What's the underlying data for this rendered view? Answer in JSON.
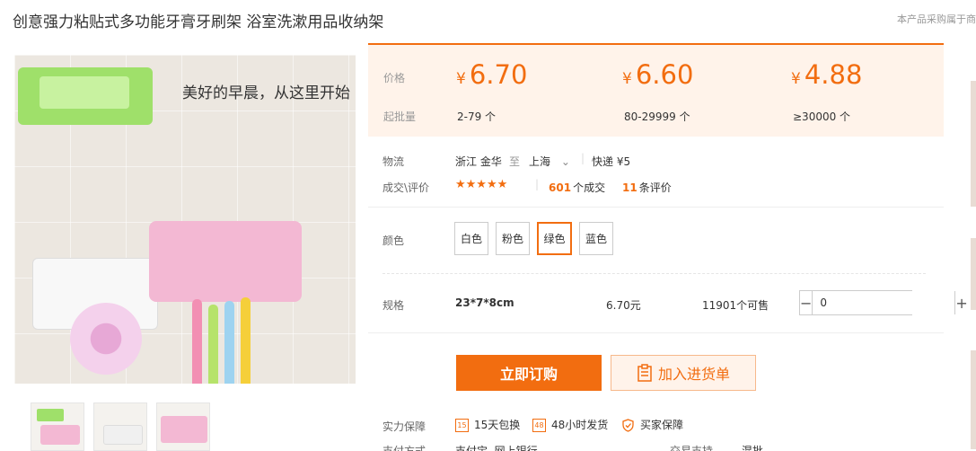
{
  "product": {
    "title": "创意强力粘贴式多功能牙膏牙刷架 浴室洗漱用品收纳架",
    "top_right_note": "本产品采购属于商",
    "image_slogan": "美好的早晨，从这里开始"
  },
  "price_panel": {
    "price_label": "价格",
    "moq_label": "起批量",
    "currency_symbol": "¥",
    "tiers": [
      {
        "price": "6.70",
        "qty": "2-79 个"
      },
      {
        "price": "6.60",
        "qty": "80-29999 个"
      },
      {
        "price": "4.88",
        "qty": "≥30000 个"
      }
    ]
  },
  "logistics": {
    "label": "物流",
    "origin": "浙江 金华",
    "to": "至",
    "destination": "上海",
    "express": "快递 ¥5"
  },
  "reviews": {
    "label": "成交\\评价",
    "stars": "★★★★★",
    "deals_count": "601",
    "deals_suffix": "个成交",
    "review_count": "11",
    "review_suffix": "条评价"
  },
  "color": {
    "label": "颜色",
    "options": [
      "白色",
      "粉色",
      "绿色",
      "蓝色"
    ],
    "selected_index": 2
  },
  "spec": {
    "label": "规格",
    "name": "23*7*8cm",
    "price": "6.70元",
    "stock": "11901个可售",
    "quantity": "0",
    "minus": "−",
    "plus": "+"
  },
  "actions": {
    "buy_now": "立即订购",
    "add_to_cart": "加入进货单"
  },
  "guarantee": {
    "label": "实力保障",
    "items": [
      {
        "icon": "15",
        "text": "15天包换"
      },
      {
        "icon": "48",
        "text": "48小时发货"
      },
      {
        "icon": "shield-icon",
        "text": "买家保障"
      }
    ]
  },
  "payment": {
    "label": "支付方式",
    "methods": "支付宝  网上银行",
    "trade_label": "交易支持",
    "trade_value": "混批"
  },
  "colors": {
    "accent": "#f26d10",
    "panel_bg": "#fff3ea"
  }
}
